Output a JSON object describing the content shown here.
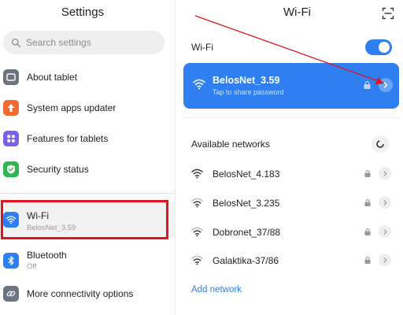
{
  "left_pane": {
    "title": "Settings",
    "search_placeholder": "Search settings",
    "items": [
      {
        "label": "About tablet",
        "icon": "tablet-icon",
        "icon_color": "#6c7480"
      },
      {
        "label": "System apps updater",
        "icon": "arrow-up-icon",
        "icon_color": "#f26a2e"
      },
      {
        "label": "Features for tablets",
        "icon": "apps-grid-icon",
        "icon_color": "#7b61e8"
      },
      {
        "label": "Security status",
        "icon": "shield-check-icon",
        "icon_color": "#2fb551"
      },
      {
        "label": "Wi-Fi",
        "sublabel": "BelosNet_3.59",
        "icon": "wifi-icon",
        "icon_color": "#2f7ff0",
        "selected": true
      },
      {
        "label": "Bluetooth",
        "sublabel": "Off",
        "icon": "bluetooth-icon",
        "icon_color": "#2f7ff0"
      },
      {
        "label": "More connectivity options",
        "icon": "link-icon",
        "icon_color": "#6c7480"
      }
    ]
  },
  "right_pane": {
    "title": "Wi-Fi",
    "wifi_toggle_label": "Wi-Fi",
    "wifi_enabled": true,
    "connected": {
      "ssid": "BelosNet_3.59",
      "subtitle": "Tap to share password"
    },
    "available_label": "Available networks",
    "networks": [
      {
        "ssid": "BelosNet_4.183"
      },
      {
        "ssid": "BelosNet_3.235"
      },
      {
        "ssid": "Dobronet_37/88"
      },
      {
        "ssid": "Galaktika-37/86"
      }
    ],
    "add_network_label": "Add network"
  },
  "colors": {
    "accent": "#2f7ff0",
    "highlight": "#e0141e"
  }
}
